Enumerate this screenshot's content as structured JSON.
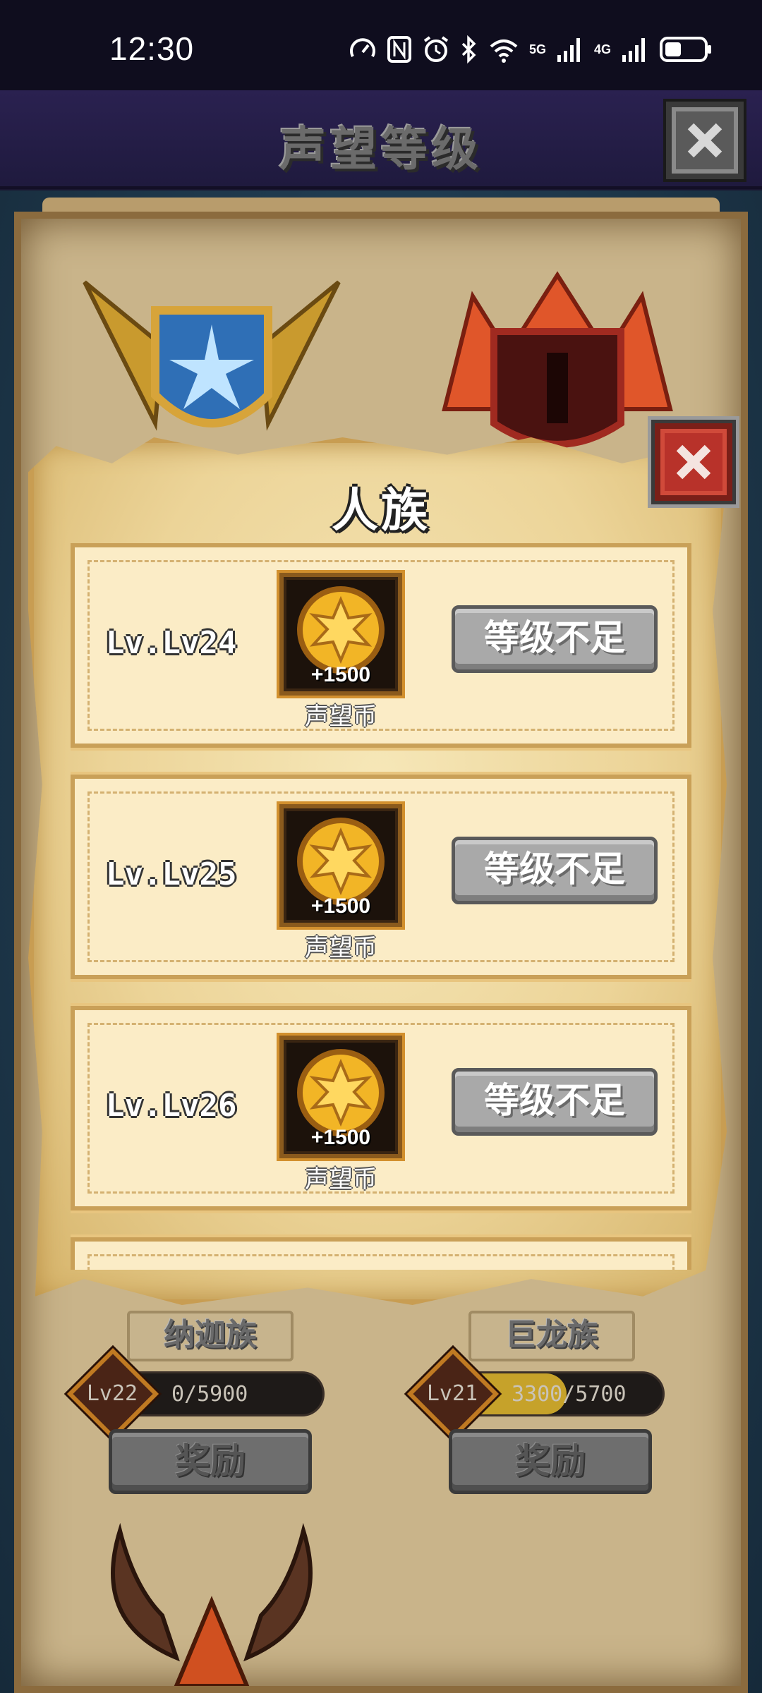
{
  "status_bar": {
    "time": "12:30",
    "network_1": "5G",
    "network_2": "4G",
    "icons": [
      "nfc-icon",
      "alarm-icon",
      "bluetooth-icon",
      "wifi-icon",
      "signal-icon",
      "battery-icon"
    ]
  },
  "header": {
    "title": "声望等级",
    "close_icon": "close-icon"
  },
  "modal": {
    "title": "人族",
    "close_icon": "close-icon",
    "rows": [
      {
        "level": "Lv.Lv24",
        "reward_amount": "+1500",
        "reward_label": "声望币",
        "button_label": "等级不足"
      },
      {
        "level": "Lv.Lv25",
        "reward_amount": "+1500",
        "reward_label": "声望币",
        "button_label": "等级不足"
      },
      {
        "level": "Lv.Lv26",
        "reward_amount": "+1500",
        "reward_label": "声望币",
        "button_label": "等级不足"
      }
    ]
  },
  "factions": [
    {
      "name": "纳迦族",
      "level": "Lv22",
      "progress_text": "0/5900",
      "progress": 0.0,
      "button_label": "奖励"
    },
    {
      "name": "巨龙族",
      "level": "Lv21",
      "progress_text": "3300/5700",
      "progress": 0.58,
      "button_label": "奖励"
    }
  ],
  "colors": {
    "header_bg": "#2a2150",
    "paper": "#f6e7b8",
    "button_disabled": "#a9a9a9",
    "close_red": "#b8322a",
    "coin_gold": "#f2b526"
  }
}
